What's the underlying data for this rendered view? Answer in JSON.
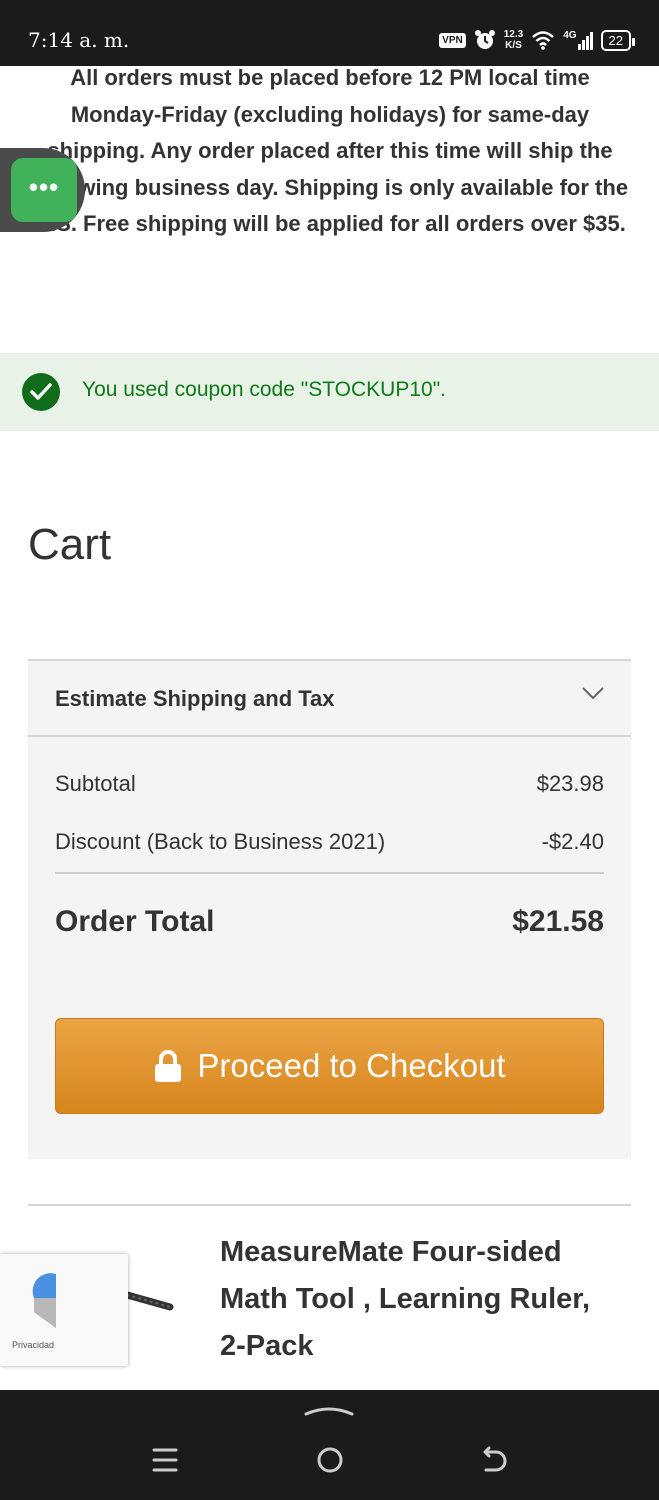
{
  "status_bar": {
    "time": "7:14 a. m.",
    "vpn": "VPN",
    "speed_value": "12.3",
    "speed_unit": "K/S",
    "network": "4G",
    "battery": "22"
  },
  "shipping_notice": "All orders must be placed before 12 PM local time Monday-Friday (excluding holidays) for same-day shipping. Any order placed after this time will ship the following business day. Shipping is only available for the U.S. Free shipping will be applied for all orders over $35.",
  "chat": {
    "icon": "more-dots-icon",
    "label": "•••"
  },
  "coupon": {
    "message": "You used coupon code \"STOCKUP10\".",
    "color": "#0f7a1a",
    "background": "#e8f2e7"
  },
  "cart": {
    "title": "Cart"
  },
  "summary": {
    "estimate_label": "Estimate Shipping and Tax",
    "subtotal_label": "Subtotal",
    "subtotal_value": "$23.98",
    "discount_label": "Discount (Back to Business 2021)",
    "discount_value": "-$2.40",
    "total_label": "Order Total",
    "total_value": "$21.58"
  },
  "checkout": {
    "label": "Proceed to Checkout",
    "color": "#e3962f"
  },
  "product": {
    "name": "MeasureMate Four-sided Math Tool , Learning Ruler, 2-Pack"
  },
  "recaptcha": {
    "label": "Privacidad"
  }
}
